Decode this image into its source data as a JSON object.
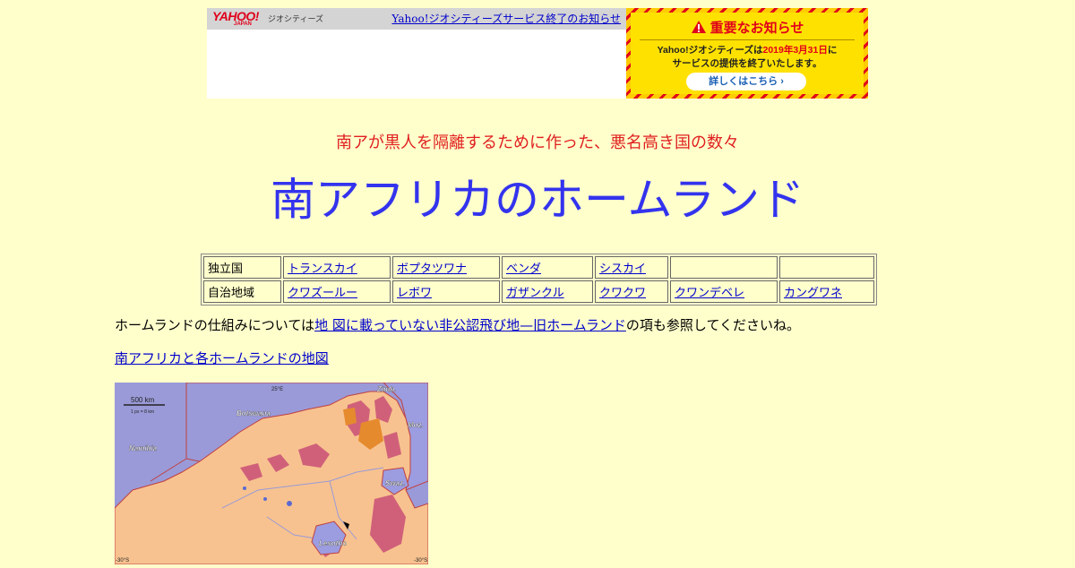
{
  "banner": {
    "logo": "YAHOO!",
    "logo_sub": "JAPAN",
    "service": "ジオシティーズ",
    "link": "Yahoo!ジオシティーズサービス終了のお知らせ"
  },
  "notice": {
    "title": "重要なお知らせ",
    "line1_pre": "Yahoo!ジオシティーズは",
    "date": "2019年3月31日",
    "line1_post": "に",
    "line2": "サービスの提供を終了いたします。",
    "button": "詳しくはこちら ›"
  },
  "subtitle": "南アが黒人を隔離するために作った、悪名高き国の数々",
  "title": "南アフリカのホームランド",
  "table": {
    "rows": [
      {
        "label": "独立国",
        "items": [
          "トランスカイ",
          "ボプタツワナ",
          "ベンダ",
          "シスカイ",
          "",
          ""
        ]
      },
      {
        "label": "自治地域",
        "items": [
          "クワズールー",
          "レボワ",
          "ガザンクル",
          "クワクワ",
          "クワンデベレ",
          "カングワネ"
        ]
      }
    ]
  },
  "paragraph": {
    "pre": "ホームランドの仕組みについては",
    "link": "地 図に載っていない非公認飛び地—旧ホームランド",
    "post": "の項も参照してくださいね。"
  },
  "map_link": "南アフリカと各ホームランドの地図",
  "map": {
    "scale": "500 km",
    "scale_sub": "1 px = 8 km",
    "lon_label": "25°E",
    "lat_left": "-30°S",
    "lat_right": "-30°S",
    "labels": [
      "Botswana",
      "Namibia",
      "Zimb.",
      "Moz.",
      "Swaz.",
      "Lesotho"
    ],
    "colors": {
      "sea": "#9a9ad8",
      "neighbor": "#9a9ad8",
      "sa": "#f7c28f",
      "homeland": "#d0607a",
      "homeland2": "#e68a2e"
    }
  }
}
